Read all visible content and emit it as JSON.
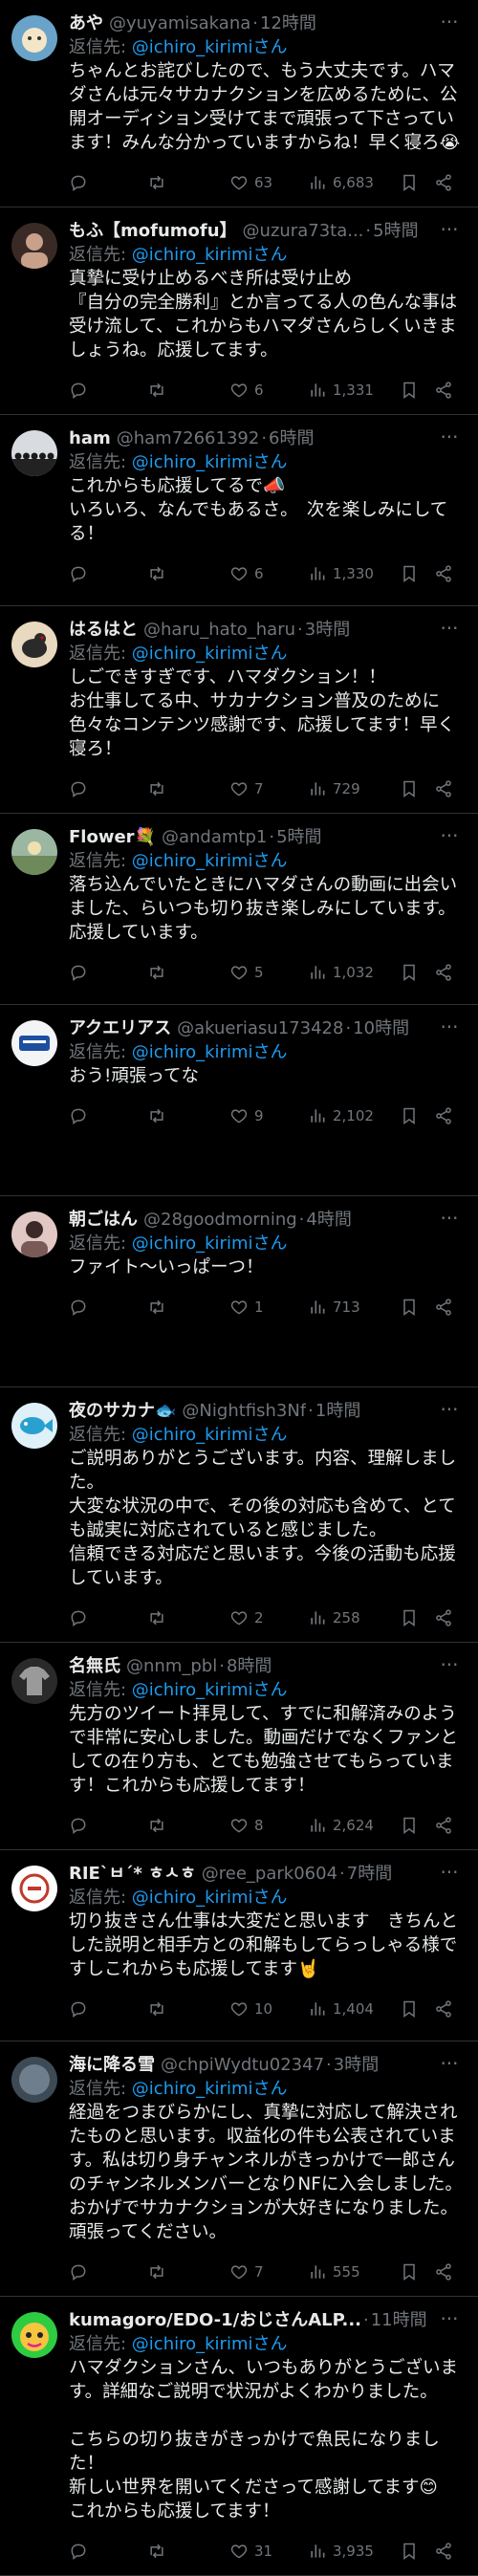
{
  "reply_prefix": "返信先: ",
  "posts": [
    {
      "name": "あや",
      "handle": "@yuyamisakana",
      "time": "12時間",
      "mention": "@ichiro_kirimiさん",
      "text": "ちゃんとお詫びしたので、もう大丈夫です。ハマダさんは元々サカナクションを広めるために、公開オーディション受けてまで頑張って下さっています！みんな分かっていますからね！早く寝ろ😭",
      "replies": "",
      "reposts": "",
      "likes": "63",
      "views": "6,683",
      "avatar": {
        "bg": "#6aa3c9",
        "fg": "#f3e6c8",
        "kind": "toy"
      }
    },
    {
      "name": "もふ【mofumofu】",
      "handle": "@uzura73ta...",
      "time": "5時間",
      "mention": "@ichiro_kirimiさん",
      "text": "真摯に受け止めるべき所は受け止め\n『自分の完全勝利』とか言ってる人の色んな事は受け流して、これからもハマダさんらしくいきましょうね。応援してます。",
      "replies": "",
      "reposts": "",
      "likes": "6",
      "views": "1,331",
      "avatar": {
        "bg": "#3a2a26",
        "fg": "#c9a18a",
        "kind": "photo"
      }
    },
    {
      "name": "ham",
      "handle": "@ham72661392",
      "time": "6時間",
      "mention": "@ichiro_kirimiさん",
      "text": "これからも応援してるで📣\nいろいろ、なんでもあるさ。　次を楽しみにしてる！",
      "replies": "",
      "reposts": "",
      "likes": "6",
      "views": "1,330",
      "avatar": {
        "bg": "#d8dce0",
        "fg": "#1a1a1a",
        "kind": "band"
      }
    },
    {
      "name": "はるはと",
      "handle": "@haru_hato_haru",
      "time": "3時間",
      "mention": "@ichiro_kirimiさん",
      "text": "しごできすぎです、ハマダクション！！\nお仕事してる中、サカナクション普及のために色々なコンテンツ感謝です、応援してます！早く寝ろ！",
      "replies": "",
      "reposts": "",
      "likes": "7",
      "views": "729",
      "avatar": {
        "bg": "#e9d9c0",
        "fg": "#2a2a2a",
        "kind": "bird"
      }
    },
    {
      "name": "Flower💐",
      "handle": "@andamtp1",
      "time": "5時間",
      "mention": "@ichiro_kirimiさん",
      "text": "落ち込んでいたときにハマダさんの動画に出会いました、らいつも切り抜き楽しみにしています。\n応援しています。",
      "replies": "",
      "reposts": "",
      "likes": "5",
      "views": "1,032",
      "avatar": {
        "bg": "#9bb7a2",
        "fg": "#f0e0b0",
        "kind": "field"
      }
    },
    {
      "name": "アクエリアス",
      "handle": "@akueriasu173428",
      "time": "10時間",
      "mention": "@ichiro_kirimiさん",
      "text": "おう!頑張ってな",
      "replies": "",
      "reposts": "",
      "likes": "9",
      "views": "2,102",
      "avatar": {
        "bg": "#f2f4f6",
        "fg": "#1d4fa0",
        "kind": "logo"
      }
    },
    {
      "name": "朝ごはん",
      "handle": "@28goodmorning",
      "time": "4時間",
      "mention": "@ichiro_kirimiさん",
      "text": "ファイト〜いっぱーつ！",
      "replies": "",
      "reposts": "",
      "likes": "1",
      "views": "713",
      "avatar": {
        "bg": "#e2c8c4",
        "fg": "#3b2a28",
        "kind": "person"
      }
    },
    {
      "name": "夜のサカナ🐟",
      "handle": "@Nightfish3Nf",
      "time": "1時間",
      "mention": "@ichiro_kirimiさん",
      "text": "ご説明ありがとうございます。内容、理解しました。\n大変な状況の中で、その後の対応も含めて、とても誠実に対応されていると感じました。\n信頼できる対応だと思います。今後の活動も応援しています。",
      "replies": "",
      "reposts": "",
      "likes": "2",
      "views": "258",
      "avatar": {
        "bg": "#dff1f8",
        "fg": "#2aa0d0",
        "kind": "fish"
      }
    },
    {
      "name": "名無氏",
      "handle": "@nnm_pbl",
      "time": "8時間",
      "mention": "@ichiro_kirimiさん",
      "text": "先方のツイート拝見して、すでに和解済みのようで非常に安心しました。動画だけでなくファンとしての在り方も、とても勉強させてもらっています！これからも応援してます！",
      "replies": "",
      "reposts": "",
      "likes": "8",
      "views": "2,624",
      "avatar": {
        "bg": "#2a2a2a",
        "fg": "#9a9a9a",
        "kind": "shirt"
      }
    },
    {
      "name": "RIE`ㅂ´* ㅎㅅㅎ",
      "handle": "@ree_park0604",
      "time": "7時間",
      "mention": "@ichiro_kirimiさん",
      "text": "切り抜きさん仕事は大変だと思います　きちんとした説明と相手方との和解もしてらっしゃる様ですしこれからも応援してます🤘",
      "replies": "",
      "reposts": "",
      "likes": "10",
      "views": "1,404",
      "avatar": {
        "bg": "#ffffff",
        "fg": "#c0392b",
        "kind": "logo-red"
      }
    },
    {
      "name": "海に降る雪",
      "handle": "@chpiWydtu02347",
      "time": "3時間",
      "mention": "@ichiro_kirimiさん",
      "text": "経過をつまびらかにし、真摯に対応して解決されたものと思います。収益化の件も公表されています。私は切り身チャンネルがきっかけで一郎さんのチャンネルメンバーとなりNFに入会しました。おかげでサカナクションが大好きになりました。頑張ってください。",
      "replies": "",
      "reposts": "",
      "likes": "7",
      "views": "555",
      "avatar": {
        "bg": "#3d4a56",
        "fg": "#6f7e8c",
        "kind": "dark"
      }
    },
    {
      "name": "kumagoro/EDO-1/おじさんALP...",
      "handle": "",
      "time": "11時間",
      "mention": "@ichiro_kirimiさん",
      "text": "ハマダクションさん、いつもありがとうございます。詳細なご説明で状況がよくわかりました。\n\nこちらの切り抜きがきっかけで魚民になりました！\n新しい世界を開いてくださって感謝してます😊\nこれからも応援してます！",
      "replies": "",
      "reposts": "",
      "likes": "31",
      "views": "3,935",
      "avatar": {
        "bg": "#2ecc40",
        "fg": "#e91e8c",
        "kind": "cartoon"
      }
    }
  ]
}
